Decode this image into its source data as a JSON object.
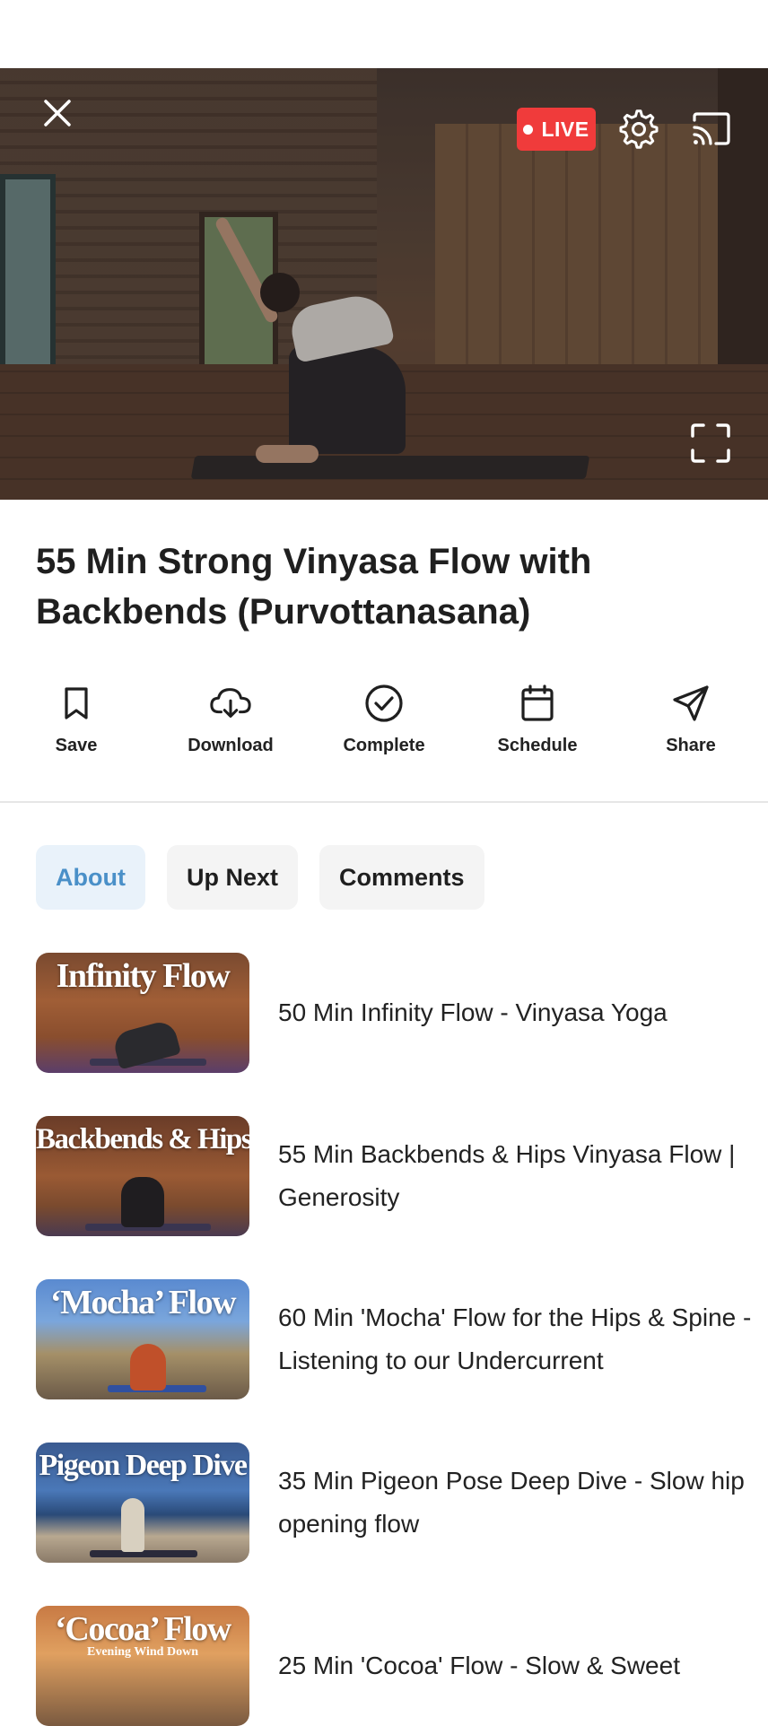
{
  "player": {
    "live_label": "LIVE",
    "colors": {
      "live_badge": "#f03b3b",
      "accent": "#4a90c8"
    },
    "icons": [
      "close-icon",
      "settings-icon",
      "cast-icon",
      "fullscreen-icon"
    ]
  },
  "video": {
    "title": "55 Min Strong Vinyasa Flow with Backbends (Purvottanasana)"
  },
  "actions": [
    {
      "label": "Save",
      "icon": "bookmark-icon"
    },
    {
      "label": "Download",
      "icon": "cloud-download-icon"
    },
    {
      "label": "Complete",
      "icon": "check-circle-icon"
    },
    {
      "label": "Schedule",
      "icon": "calendar-icon"
    },
    {
      "label": "Share",
      "icon": "send-icon"
    }
  ],
  "tabs": [
    {
      "label": "About",
      "active": true
    },
    {
      "label": "Up Next",
      "active": false
    },
    {
      "label": "Comments",
      "active": false
    }
  ],
  "up_next": [
    {
      "thumb_text": "Infinity Flow",
      "thumb_sub": "",
      "title": "50 Min Infinity Flow - Vinyasa Yoga"
    },
    {
      "thumb_text": "Backbends & Hips",
      "thumb_sub": "",
      "title": "55 Min Backbends & Hips Vinyasa Flow | Generosity"
    },
    {
      "thumb_text": "‘Mocha’ Flow",
      "thumb_sub": "",
      "title": "60 Min 'Mocha' Flow for the Hips & Spine - Listening to our Undercurrent"
    },
    {
      "thumb_text": "Pigeon Deep Dive",
      "thumb_sub": "",
      "title": "35 Min Pigeon Pose Deep Dive - Slow hip opening flow"
    },
    {
      "thumb_text": "‘Cocoa’ Flow",
      "thumb_sub": "Evening Wind Down",
      "title": "25 Min 'Cocoa' Flow - Slow & Sweet"
    }
  ]
}
